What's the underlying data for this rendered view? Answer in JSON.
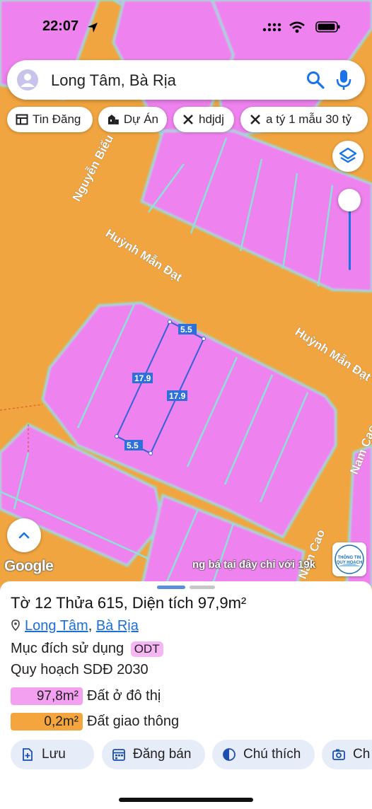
{
  "status": {
    "time": "22:07"
  },
  "search": {
    "query": "Long Tâm, Bà Rịa"
  },
  "chips": [
    {
      "label": "Tin Đăng",
      "icon": "newspaper-icon"
    },
    {
      "label": "Dự Án",
      "icon": "buildings-icon"
    },
    {
      "label": "hdjdj",
      "icon": "pencil-ruler-icon"
    },
    {
      "label": "a tý 1 mẫu 30 tỷ",
      "icon": "pencil-ruler-icon"
    }
  ],
  "map": {
    "streets": {
      "nguyen_bieu": "Nguyễn Biểu",
      "huynh_man_dat_1": "Huỳnh Mẫn Đạt",
      "huynh_man_dat_2": "Huỳnh Mẫn Đạt",
      "nam_cao_1": "Nam Cao",
      "nam_cao_2": "Nam Cao"
    },
    "dimensions": {
      "top": "5.5",
      "bottom": "5.5",
      "left": "17.9",
      "right": "17.9"
    },
    "colors": {
      "residential": "#ee82ee",
      "traffic": "#f2a541",
      "boundary": "#2f63d8"
    },
    "google_label": "Google",
    "ad_text": "ng bá tại đây chỉ với 19k",
    "badge_text_1": "THÔNG TIN",
    "badge_text_2": "QUY HOẠCH"
  },
  "sheet": {
    "title": "Tờ 12 Thửa 615, Diện tích 97,9m²",
    "location": {
      "ward": "Long Tâm",
      "separator": ", ",
      "city": "Bà Rịa"
    },
    "purpose_label": "Mục đích sử dụng",
    "purpose_code": "ODT",
    "plan_label": "Quy hoạch SDĐ 2030",
    "zones": [
      {
        "area": "97,8m²",
        "label": "Đất ở đô thị",
        "color": "#f3a0f0"
      },
      {
        "area": "0,2m²",
        "label": "Đất giao thông",
        "color": "#f5a53e"
      }
    ],
    "actions": [
      {
        "label": "Lưu",
        "icon": "save-icon"
      },
      {
        "label": "Đăng bán",
        "icon": "calendar-icon"
      },
      {
        "label": "Chú thích",
        "icon": "legend-icon"
      },
      {
        "label": "Ch",
        "icon": "camera-icon"
      }
    ]
  }
}
